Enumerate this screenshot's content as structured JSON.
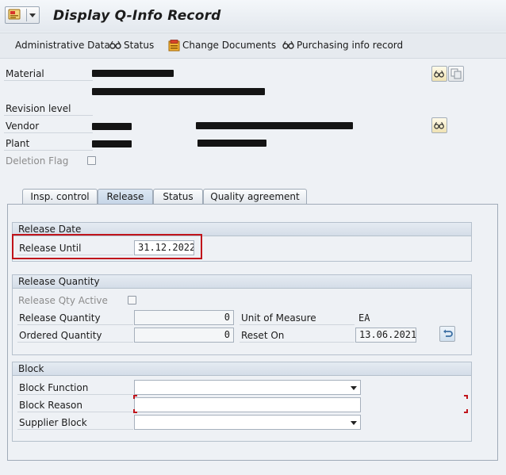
{
  "window": {
    "title": "Display Q-Info Record"
  },
  "toolbar": {
    "items": [
      {
        "label": "Administrative Data",
        "icon": ""
      },
      {
        "label": "Status",
        "icon": "glasses-icon"
      },
      {
        "label": "Change Documents",
        "icon": "change-documents-icon"
      },
      {
        "label": "Purchasing info record",
        "icon": "glasses-icon"
      }
    ]
  },
  "header": {
    "material_label": "Material",
    "revision_label": "Revision level",
    "vendor_label": "Vendor",
    "plant_label": "Plant",
    "deletion_flag_label": "Deletion Flag",
    "deletion_flag_checked": false
  },
  "tabs": [
    {
      "label": "Insp. control",
      "active": false
    },
    {
      "label": "Release",
      "active": true
    },
    {
      "label": "Status",
      "active": false
    },
    {
      "label": "Quality agreement",
      "active": false
    }
  ],
  "release_date": {
    "title": "Release Date",
    "release_until_label": "Release Until",
    "release_until_value": "31.12.2022"
  },
  "release_quantity": {
    "title": "Release Quantity",
    "qty_active_label": "Release Qty Active",
    "qty_active_checked": false,
    "release_quantity_label": "Release Quantity",
    "release_quantity_value": "0",
    "ordered_quantity_label": "Ordered Quantity",
    "ordered_quantity_value": "0",
    "uom_label": "Unit of Measure",
    "uom_value": "EA",
    "reset_on_label": "Reset On",
    "reset_on_value": "13.06.2021"
  },
  "block": {
    "title": "Block",
    "block_function_label": "Block Function",
    "block_function_value": "",
    "block_reason_label": "Block Reason",
    "block_reason_value": "",
    "supplier_block_label": "Supplier Block",
    "supplier_block_value": ""
  },
  "colors": {
    "highlight_border": "#c0141b",
    "active_tab": "#c5d5e7",
    "background": "#eef1f5"
  }
}
